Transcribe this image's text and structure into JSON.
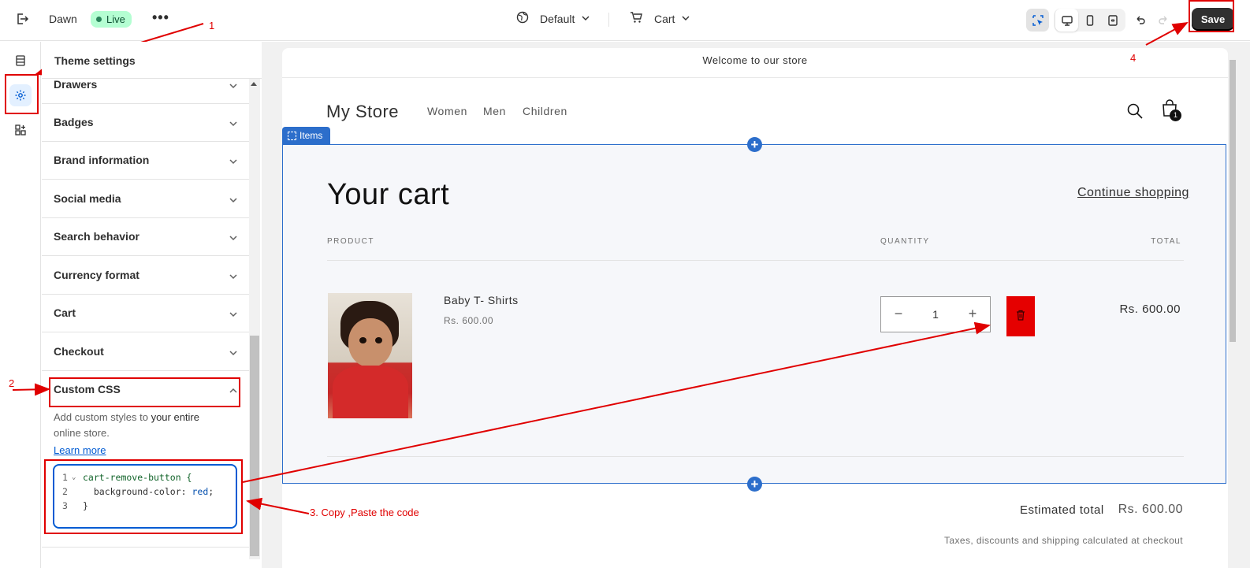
{
  "topbar": {
    "theme_name": "Dawn",
    "status_badge": "Live",
    "more_label": "•••",
    "template_selector": "Default",
    "page_selector": "Cart",
    "save_label": "Save"
  },
  "sidebar": {
    "rail_items": [
      {
        "icon": "sections-icon"
      },
      {
        "icon": "theme-settings-icon",
        "active": true
      },
      {
        "icon": "app-embeds-icon"
      }
    ]
  },
  "panel": {
    "title": "Theme settings",
    "sections": [
      {
        "label": "Drawers"
      },
      {
        "label": "Badges"
      },
      {
        "label": "Brand information"
      },
      {
        "label": "Social media"
      },
      {
        "label": "Search behavior"
      },
      {
        "label": "Currency format"
      },
      {
        "label": "Cart"
      },
      {
        "label": "Checkout"
      },
      {
        "label": "Custom CSS",
        "expanded": true
      }
    ],
    "custom_css": {
      "desc_prefix": "Add custom styles to ",
      "desc_bold": "your entire",
      "desc_suffix": "online store.",
      "learn_more": "Learn more",
      "code_lines": [
        {
          "num": "1",
          "selector": "cart-remove-button {",
          "fold": "⌄"
        },
        {
          "num": "2",
          "prop": "  background-color: ",
          "value": "red",
          "end": ";"
        },
        {
          "num": "3",
          "text": "}"
        }
      ]
    }
  },
  "preview": {
    "announcement": "Welcome to our store",
    "store_name": "My Store",
    "nav": [
      "Women",
      "Men",
      "Children"
    ],
    "cart_count": "1",
    "section_tab": "Items",
    "cart_title": "Your cart",
    "continue_shopping": "Continue shopping",
    "columns": {
      "product": "PRODUCT",
      "quantity": "QUANTITY",
      "total": "TOTAL"
    },
    "item": {
      "name": "Baby T- Shirts",
      "price": "Rs. 600.00",
      "quantity": "1",
      "line_total": "Rs. 600.00"
    },
    "estimated_total_label": "Estimated total",
    "estimated_total_value": "Rs. 600.00",
    "tax_note": "Taxes, discounts and shipping calculated at checkout"
  },
  "annotations": {
    "step1": "1",
    "step2": "2",
    "step3": "3. Copy ,Paste the code",
    "step4": "4"
  },
  "colors": {
    "accent": "#2c6ecb",
    "annotation": "#e00000",
    "remove_button": "#e50000",
    "live_badge_bg": "#b4fed2"
  }
}
